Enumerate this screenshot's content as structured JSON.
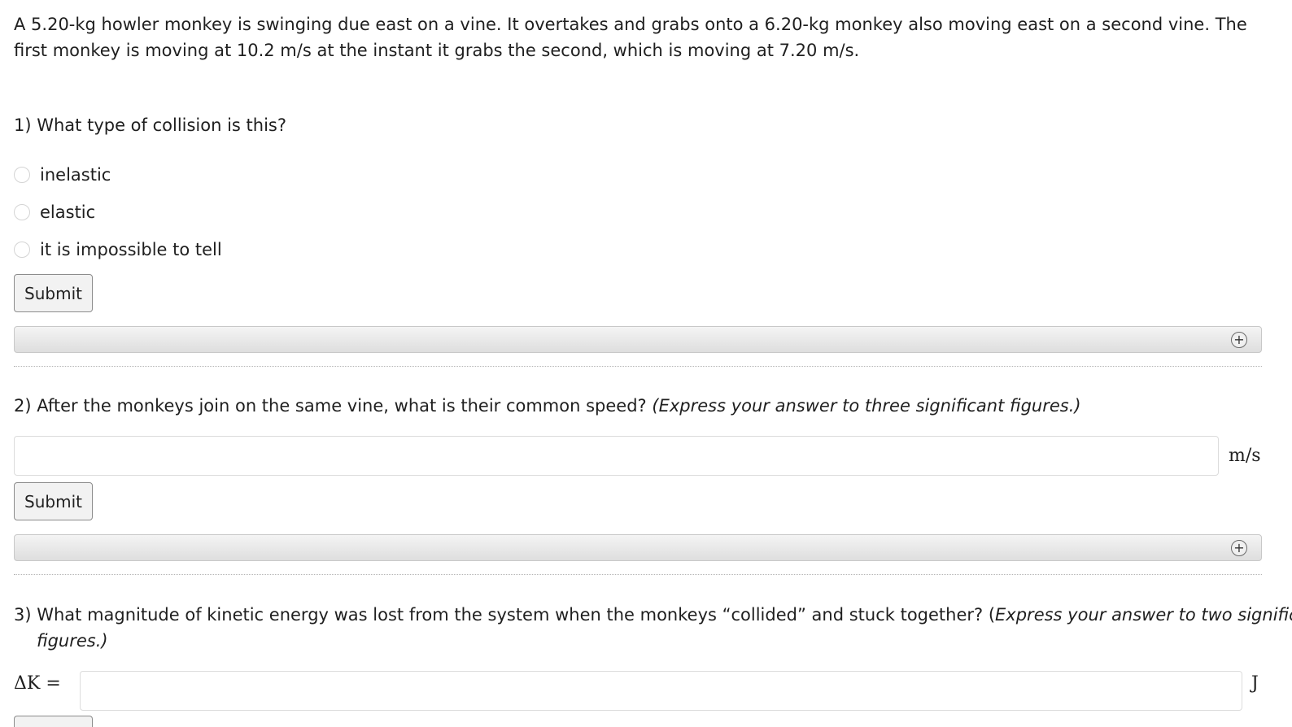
{
  "problem": {
    "intro": "A 5.20-kg howler monkey is swinging due east on a vine. It overtakes and grabs onto a 6.20-kg monkey also moving east on a second vine. The first monkey is moving at 10.2 m/s at the instant it grabs the second, which is moving at 7.20 m/s."
  },
  "q1": {
    "title": "1) What type of collision is this?",
    "options": [
      "inelastic",
      "elastic",
      "it is impossible to tell"
    ],
    "submit_label": "Submit",
    "expand_icon": "plus-circle-icon"
  },
  "q2": {
    "title": "2) After the monkeys join on the same vine, what is their common speed?",
    "note": "(Express your answer to three significant figures.)",
    "input_value": "",
    "unit": "m/s",
    "submit_label": "Submit",
    "expand_icon": "plus-circle-icon"
  },
  "q3": {
    "title_line1": "3) What magnitude of kinetic energy was lost from the system when the monkeys “collided” and stuck together? (",
    "note_line1": "Express your answer to two significant",
    "note_line2": "figures.)",
    "symbol": "ΔK",
    "equals": "=",
    "input_value": "",
    "unit": "J"
  },
  "colors": {
    "text": "#1f1f1f",
    "button_bg": "#f2f2f2",
    "bar_bg": "#e6e6e6"
  }
}
